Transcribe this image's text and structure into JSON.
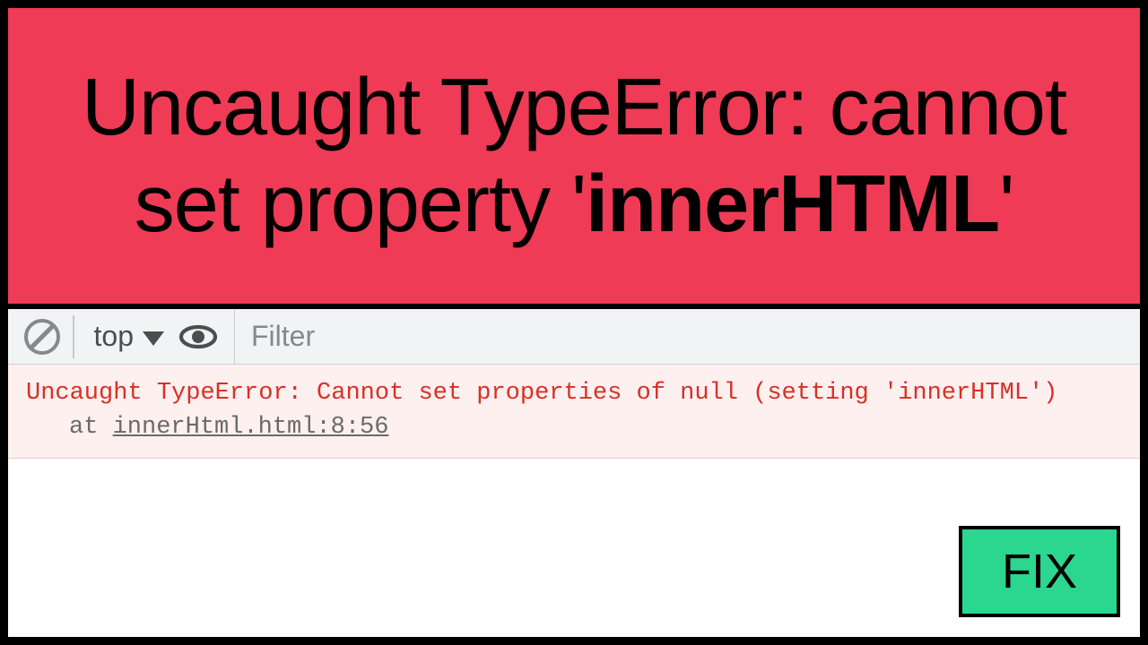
{
  "hero": {
    "line1_prefix": "Uncaught TypeError: cannot",
    "line2_prefix": "set property '",
    "line2_bold": "innerHTML",
    "line2_suffix": "'"
  },
  "toolbar": {
    "context_label": "top",
    "filter_placeholder": "Filter"
  },
  "console": {
    "message": "Uncaught TypeError: Cannot set properties of null (setting 'innerHTML')",
    "at_prefix": "at ",
    "at_location": "innerHtml.html:8:56"
  },
  "fix": {
    "label": "FIX"
  },
  "colors": {
    "hero_bg": "#ef3b55",
    "error_bg": "#fdf0ef",
    "error_text": "#d93025",
    "fix_bg": "#2bd68f"
  }
}
